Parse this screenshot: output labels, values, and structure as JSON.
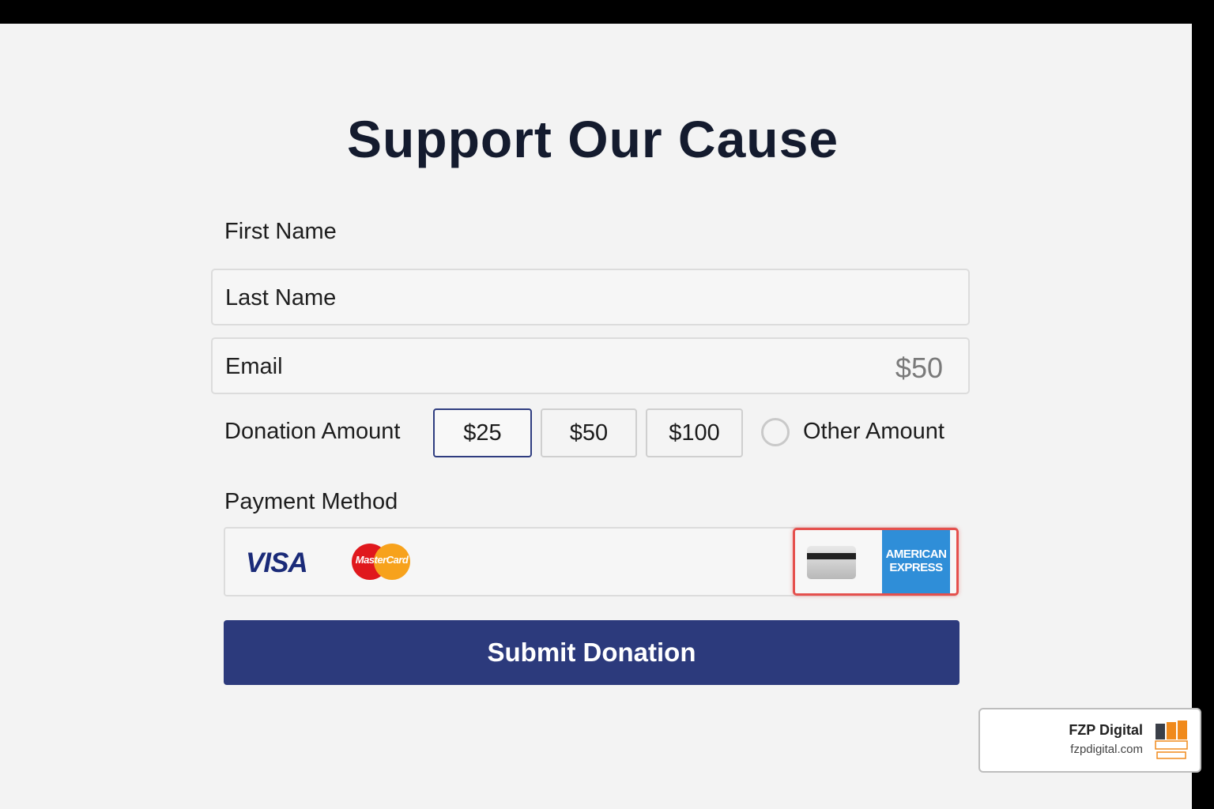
{
  "form": {
    "title": "Support Our Cause",
    "first_name_label": "First Name",
    "last_name_placeholder": "Last Name",
    "email_placeholder": "Email",
    "email_side_value": "$50",
    "donation_label": "Donation Amount",
    "amounts": [
      "$25",
      "$50",
      "$100"
    ],
    "selected_amount": "$25",
    "other_amount_label": "Other Amount",
    "payment_label": "Payment Method",
    "payment_methods": {
      "visa": "VISA",
      "mastercard": "MasterCard",
      "amex_line1": "AMERICAN",
      "amex_line2": "EXPRESS"
    },
    "submit_label": "Submit Donation"
  },
  "brand": {
    "name": "FZP Digital",
    "url": "fzpdigital.com"
  },
  "colors": {
    "primary": "#2c3a7c",
    "title": "#141b2e",
    "highlight": "#e5504d",
    "amex": "#2f8ed8",
    "mc_red": "#e0181d",
    "mc_orange": "#f7a21c",
    "brand_orange": "#f08a1c"
  }
}
